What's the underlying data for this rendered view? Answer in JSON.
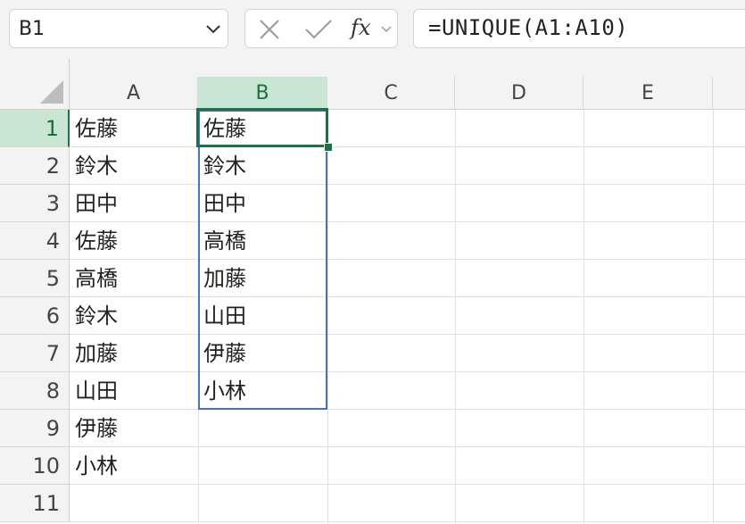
{
  "name_box": {
    "value": "B1"
  },
  "formula_bar": {
    "cancel_icon": "x-icon",
    "enter_icon": "check-icon",
    "function_label": "fx",
    "formula": "=UNIQUE(A1:A10)"
  },
  "columns": [
    "A",
    "B",
    "C",
    "D",
    "E"
  ],
  "selected_column": "B",
  "rows": [
    "1",
    "2",
    "3",
    "4",
    "5",
    "6",
    "7",
    "8",
    "9",
    "10",
    "11"
  ],
  "selected_row": "1",
  "column_a": [
    "佐藤",
    "鈴木",
    "田中",
    "佐藤",
    "高橋",
    "鈴木",
    "加藤",
    "山田",
    "伊藤",
    "小林"
  ],
  "column_b": [
    "佐藤",
    "鈴木",
    "田中",
    "高橋",
    "加藤",
    "山田",
    "伊藤",
    "小林"
  ],
  "colors": {
    "selection_green": "#1e7145",
    "spill_blue": "#4472c4",
    "header_highlight": "#c8e6d3"
  }
}
